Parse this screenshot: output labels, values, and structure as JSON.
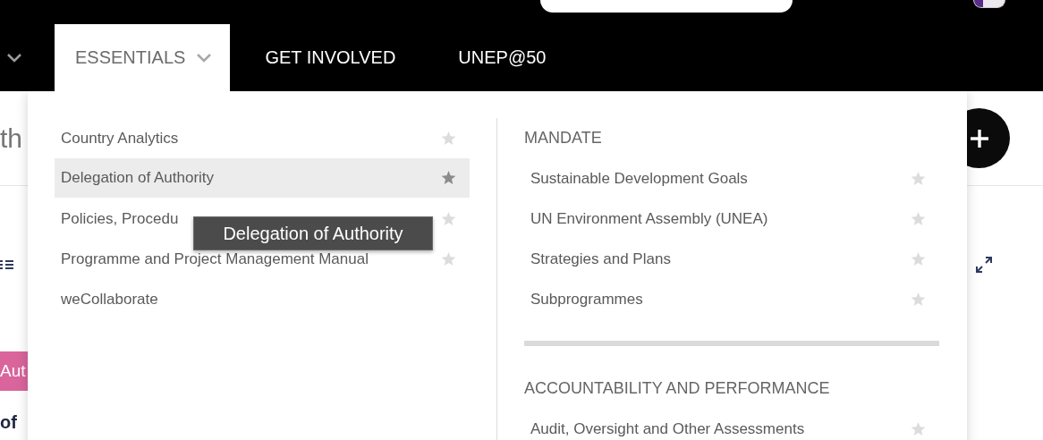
{
  "nav": {
    "tabs": [
      {
        "label": "ESSENTIALS",
        "selected": true,
        "has_menu": true
      },
      {
        "label": "GET INVOLVED",
        "selected": false,
        "has_menu": false
      },
      {
        "label": "UNEP@50",
        "selected": false,
        "has_menu": false
      }
    ]
  },
  "background": {
    "heading_fragment": "th",
    "tag_fragment": "Aut",
    "title_fragment": "of"
  },
  "menu": {
    "left_items": [
      {
        "label": "Country Analytics",
        "highlighted": false,
        "favorite": false
      },
      {
        "label": "Delegation of Authority",
        "highlighted": true,
        "favorite": true
      },
      {
        "label": "Policies, Procedu",
        "highlighted": false,
        "favorite": false
      },
      {
        "label": "Programme and Project Management Manual",
        "highlighted": false,
        "favorite": false
      },
      {
        "label": "weCollaborate",
        "highlighted": false
      }
    ],
    "sections": [
      {
        "heading": "MANDATE",
        "items": [
          {
            "label": "Sustainable Development Goals",
            "favorite": false
          },
          {
            "label": "UN Environment Assembly (UNEA)",
            "favorite": false
          },
          {
            "label": "Strategies and Plans",
            "favorite": false
          },
          {
            "label": "Subprogrammes",
            "favorite": false
          }
        ]
      },
      {
        "heading": "ACCOUNTABILITY AND PERFORMANCE",
        "items": [
          {
            "label": "Audit, Oversight and Other Assessments",
            "favorite": false
          }
        ]
      }
    ],
    "tooltip": "Delegation of Authority"
  }
}
